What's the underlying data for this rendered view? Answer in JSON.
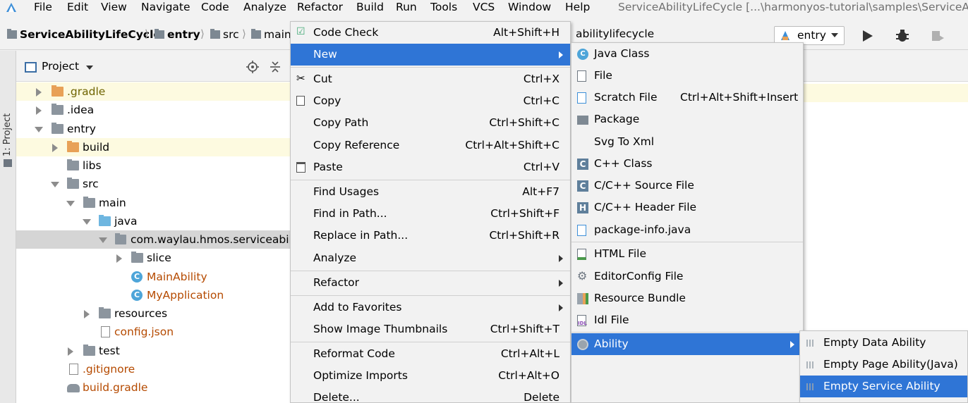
{
  "menubar": {
    "items": [
      "File",
      "Edit",
      "View",
      "Navigate",
      "Code",
      "Analyze",
      "Refactor",
      "Build",
      "Run",
      "Tools",
      "VCS",
      "Window",
      "Help"
    ],
    "window_title": "ServiceAbilityLifeCycle [...\\harmonyos-tutorial\\samples\\ServiceAbili"
  },
  "navbar": {
    "crumbs": [
      "ServiceAbilityLifeCycle",
      "entry",
      "src",
      "main"
    ],
    "crumb_tail": "abilitylifecycle",
    "run_config": "entry"
  },
  "toolstrip": {
    "label": "1: Project"
  },
  "project": {
    "title": "Project",
    "tree": [
      {
        "label": ".gradle",
        "color": "olive"
      },
      {
        "label": ".idea"
      },
      {
        "label": "entry"
      },
      {
        "label": "build"
      },
      {
        "label": "libs"
      },
      {
        "label": "src"
      },
      {
        "label": "main"
      },
      {
        "label": "java"
      },
      {
        "label": "com.waylau.hmos.serviceability"
      },
      {
        "label": "slice"
      },
      {
        "label": "MainAbility",
        "color": "orange"
      },
      {
        "label": "MyApplication",
        "color": "orange"
      },
      {
        "label": "resources"
      },
      {
        "label": "config.json",
        "color": "orange"
      },
      {
        "label": "test"
      },
      {
        "label": ".gitignore",
        "color": "orange"
      },
      {
        "label": "build.gradle",
        "color": "orange"
      }
    ]
  },
  "context_menu": {
    "items": [
      {
        "label": "Code Check",
        "shortcut": "Alt+Shift+H",
        "icon": "code-check-icon"
      },
      {
        "label": "New",
        "shortcut": "",
        "icon": "",
        "submenu": true
      },
      {
        "label": "Cut",
        "shortcut": "Ctrl+X",
        "icon": "scissors-icon"
      },
      {
        "label": "Copy",
        "shortcut": "Ctrl+C",
        "icon": "copy-icon"
      },
      {
        "label": "Copy Path",
        "shortcut": "Ctrl+Shift+C",
        "icon": ""
      },
      {
        "label": "Copy Reference",
        "shortcut": "Ctrl+Alt+Shift+C",
        "icon": ""
      },
      {
        "label": "Paste",
        "shortcut": "Ctrl+V",
        "icon": "clipboard-icon"
      },
      {
        "label": "Find Usages",
        "shortcut": "Alt+F7",
        "icon": ""
      },
      {
        "label": "Find in Path...",
        "shortcut": "Ctrl+Shift+F",
        "icon": ""
      },
      {
        "label": "Replace in Path...",
        "shortcut": "Ctrl+Shift+R",
        "icon": ""
      },
      {
        "label": "Analyze",
        "shortcut": "",
        "icon": "",
        "submenu": true
      },
      {
        "label": "Refactor",
        "shortcut": "",
        "icon": "",
        "submenu": true
      },
      {
        "label": "Add to Favorites",
        "shortcut": "",
        "icon": "",
        "submenu": true
      },
      {
        "label": "Show Image Thumbnails",
        "shortcut": "Ctrl+Shift+T",
        "icon": ""
      },
      {
        "label": "Reformat Code",
        "shortcut": "Ctrl+Alt+L",
        "icon": ""
      },
      {
        "label": "Optimize Imports",
        "shortcut": "Ctrl+Alt+O",
        "icon": ""
      },
      {
        "label": "Delete...",
        "shortcut": "Delete",
        "icon": ""
      }
    ]
  },
  "new_submenu": {
    "items": [
      {
        "label": "Java Class",
        "shortcut": "",
        "icon": "java-class-icon"
      },
      {
        "label": "File",
        "shortcut": "",
        "icon": "file-icon"
      },
      {
        "label": "Scratch File",
        "shortcut": "Ctrl+Alt+Shift+Insert",
        "icon": "scratch-file-icon"
      },
      {
        "label": "Package",
        "shortcut": "",
        "icon": "package-icon"
      },
      {
        "label": "Svg To Xml",
        "shortcut": "",
        "icon": ""
      },
      {
        "label": "C++ Class",
        "shortcut": "",
        "icon": "cpp-class-icon"
      },
      {
        "label": "C/C++ Source File",
        "shortcut": "",
        "icon": "c-source-icon"
      },
      {
        "label": "C/C++ Header File",
        "shortcut": "",
        "icon": "c-header-icon"
      },
      {
        "label": "package-info.java",
        "shortcut": "",
        "icon": "package-info-icon"
      },
      {
        "label": "HTML File",
        "shortcut": "",
        "icon": "html-file-icon"
      },
      {
        "label": "EditorConfig File",
        "shortcut": "",
        "icon": "gear-icon"
      },
      {
        "label": "Resource Bundle",
        "shortcut": "",
        "icon": "resource-bundle-icon"
      },
      {
        "label": "Idl File",
        "shortcut": "",
        "icon": "idl-file-icon"
      },
      {
        "label": "Ability",
        "shortcut": "",
        "icon": "ability-icon",
        "submenu": true
      }
    ]
  },
  "ability_submenu": {
    "items": [
      {
        "label": "Empty Data Ability"
      },
      {
        "label": "Empty Page Ability(Java)"
      },
      {
        "label": "Empty Service Ability"
      }
    ]
  },
  "colors": {
    "highlight": "#2f75d6",
    "menu_bg": "#f2f2f2",
    "tree_selected": "#d5d5d5",
    "tree_yellow": "#fdfae0",
    "file_orange": "#b54a00"
  }
}
